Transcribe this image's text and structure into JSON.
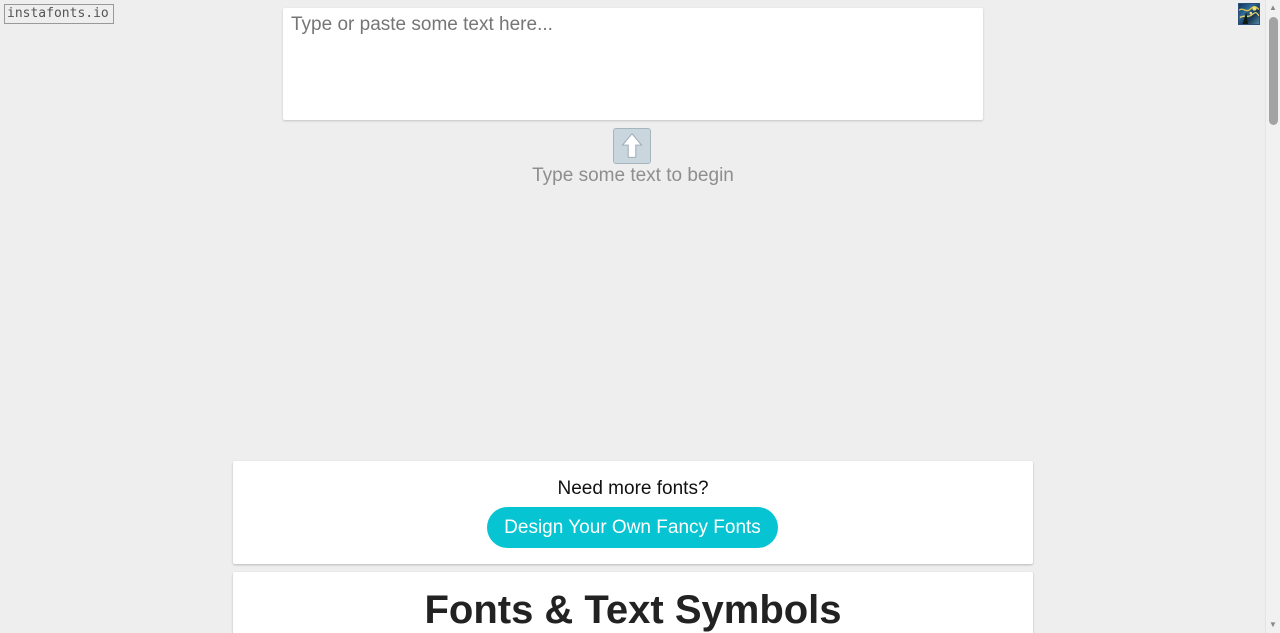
{
  "header": {
    "site_link": "instafonts.io",
    "corner_image": "starry-night-thumbnail"
  },
  "input": {
    "placeholder": "Type or paste some text here...",
    "value": ""
  },
  "hint": {
    "icon": "up-arrow-icon",
    "text": "Type some text to begin"
  },
  "more_fonts": {
    "title": "Need more fonts?",
    "button_label": "Design Your Own Fancy Fonts",
    "button_color": "#07c4d2"
  },
  "symbols_section": {
    "title": "Fonts & Text Symbols"
  },
  "colors": {
    "page_background": "#eeeeee",
    "card_background": "#ffffff",
    "hint_text": "#8e8e8e"
  }
}
